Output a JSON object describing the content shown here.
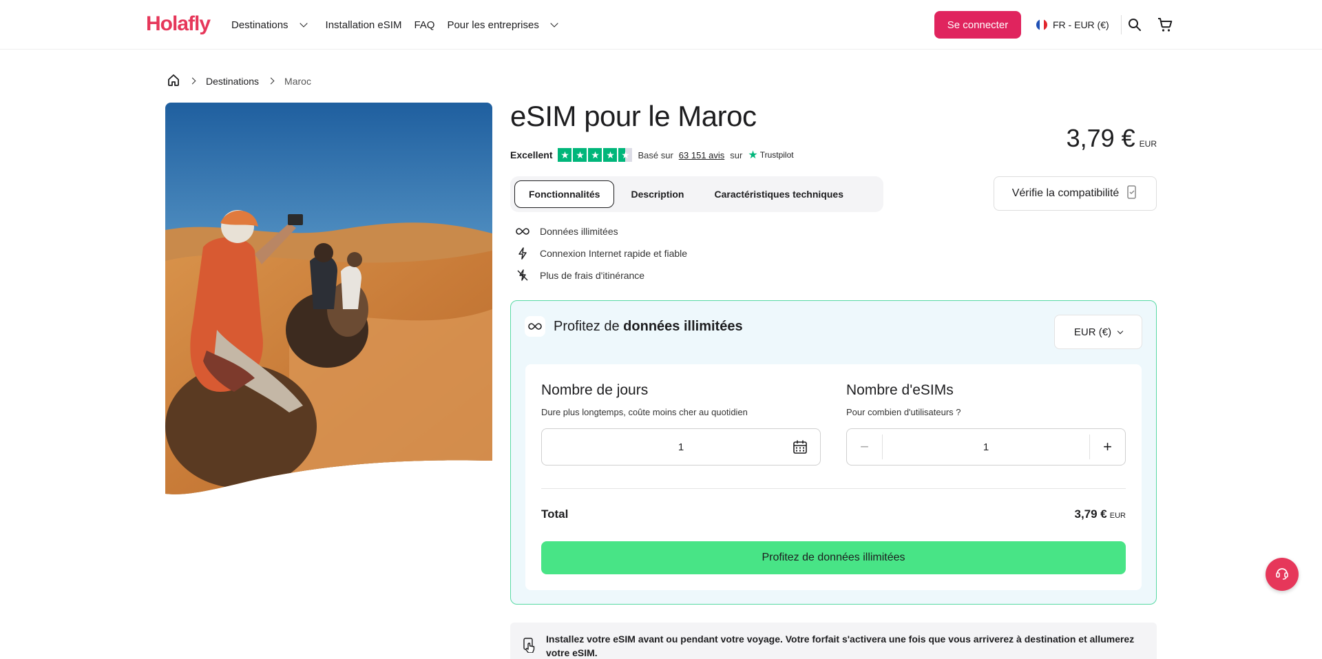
{
  "header": {
    "logo": "Holafly",
    "nav": [
      {
        "label": "Destinations",
        "has_dropdown": true
      },
      {
        "label": "Installation eSIM",
        "has_dropdown": false
      },
      {
        "label": "FAQ",
        "has_dropdown": false
      },
      {
        "label": "Pour les entreprises",
        "has_dropdown": true
      }
    ],
    "login_label": "Se connecter",
    "locale_label": "FR - EUR (€)",
    "icons": [
      "france-flag-icon",
      "search-icon",
      "cart-icon"
    ]
  },
  "breadcrumb": {
    "items": [
      "Destinations",
      "Maroc"
    ],
    "icons": [
      "home-icon"
    ]
  },
  "product": {
    "title": "eSIM pour le Maroc",
    "price": "3,79 €",
    "currency": "EUR",
    "rating": {
      "label": "Excellent",
      "based_on": "Basé sur",
      "reviews": "63 151 avis",
      "on": "sur",
      "provider": "Trustpilot",
      "stars": 4.5
    },
    "tabs": [
      {
        "label": "Fonctionnalités",
        "active": true
      },
      {
        "label": "Description",
        "active": false
      },
      {
        "label": "Caractéristiques techniques",
        "active": false
      }
    ],
    "compat_label": "Vérifie la compatibilité",
    "features": [
      {
        "icon": "infinity-icon",
        "label": "Données illimitées"
      },
      {
        "icon": "lightning-icon",
        "label": "Connexion Internet rapide et fiable"
      },
      {
        "icon": "no-roaming-icon",
        "label": "Plus de frais d'itinérance"
      }
    ]
  },
  "plan": {
    "title_prefix": "Profitez de",
    "title_bold": "données illimitées",
    "currency_select": "EUR (€)",
    "days": {
      "heading": "Nombre de jours",
      "hint": "Dure plus longtemps, coûte moins cher au quotidien",
      "value": "1"
    },
    "esims": {
      "heading": "Nombre d'eSIMs",
      "hint": "Pour combien d'utilisateurs ?",
      "value": "1"
    },
    "total_label": "Total",
    "total_price": "3,79 €",
    "total_currency": "EUR",
    "cta_label": "Profitez de données illimitées"
  },
  "info_banner": {
    "text": "Installez votre eSIM avant ou pendant votre voyage. Votre forfait s'activera une fois que vous arriverez à destination et allumerez votre eSIM."
  },
  "colors": {
    "brand": "#e6375a",
    "login_bg": "#e0245e",
    "cta_green": "#48e486",
    "plan_border": "#57d9a3",
    "plan_bg": "#eef8fc",
    "trustpilot": "#00b67a"
  }
}
